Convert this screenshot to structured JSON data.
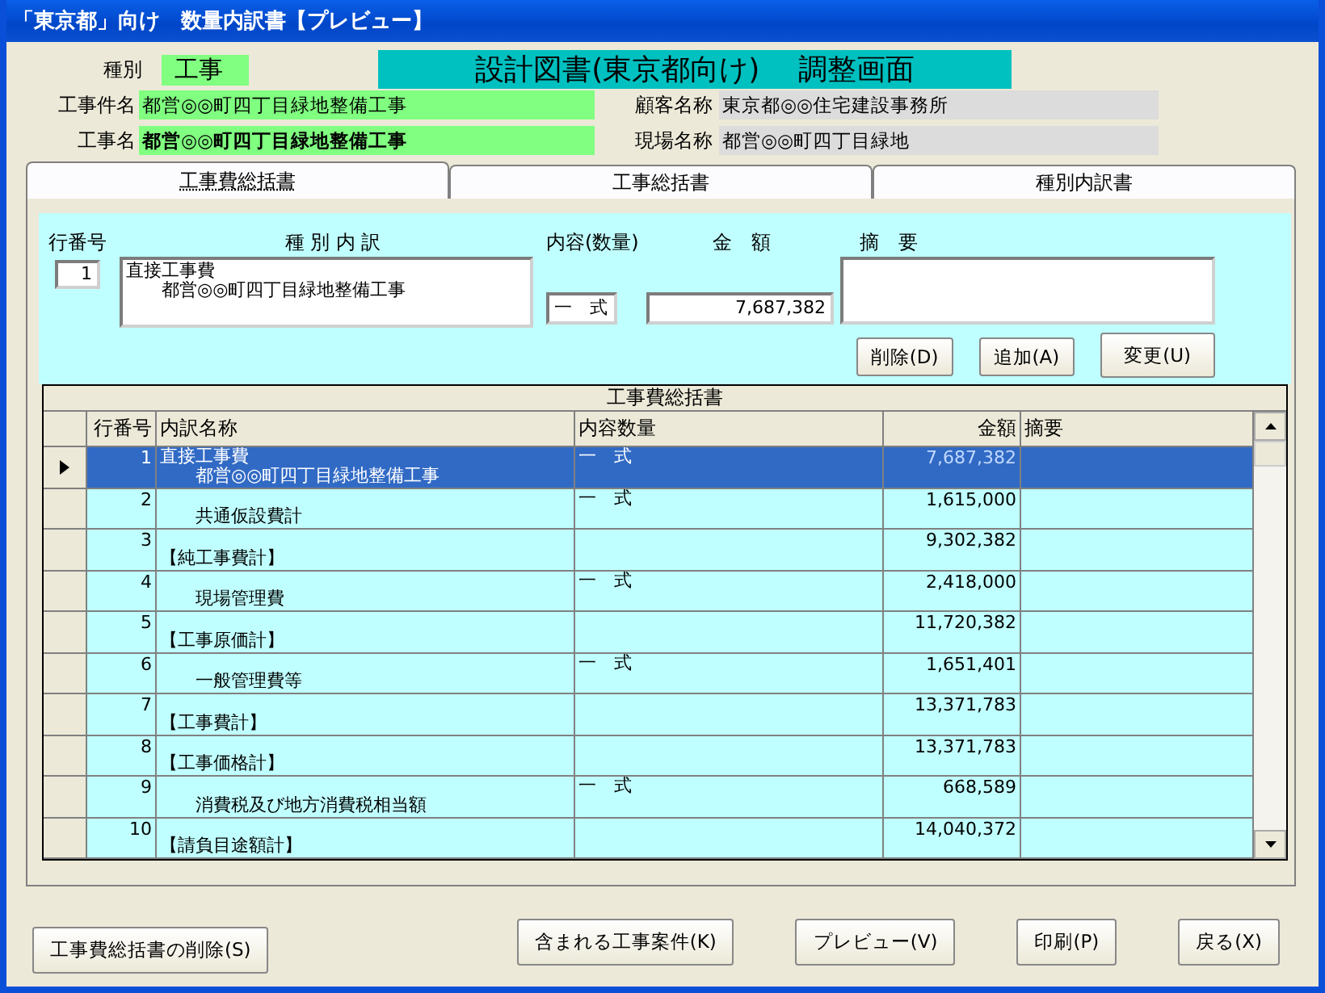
{
  "window": {
    "title": "「東京都」向け　数量内訳書【プレビュー】"
  },
  "header": {
    "type_label": "種別",
    "type_value": "工事",
    "banner": "設計図書(東京都向け)　 調整画面",
    "fields": [
      {
        "label": "工事件名",
        "value": "都営◎◎町四丁目緑地整備工事",
        "kind": "green"
      },
      {
        "label": "顧客名称",
        "value": "東京都◎◎住宅建設事務所",
        "kind": "grey"
      },
      {
        "label": "工事名",
        "value": "都営◎◎町四丁目緑地整備工事",
        "kind": "greenbold"
      },
      {
        "label": "現場名称",
        "value": "都営◎◎町四丁目緑地",
        "kind": "grey"
      }
    ]
  },
  "tabs": [
    {
      "label": "工事費総括書",
      "selected": true
    },
    {
      "label": "工事総括書",
      "selected": false
    },
    {
      "label": "種別内訳書",
      "selected": false
    }
  ],
  "detail": {
    "row_no_label": "行番号",
    "row_no": "1",
    "breakdown_label": "種 別 内 訳",
    "breakdown_lines": [
      "直接工事費",
      "　　都営◎◎町四丁目緑地整備工事"
    ],
    "qty_label": "内容(数量)",
    "qty": "一　式",
    "amount_label": "金　額",
    "amount": "7,687,382",
    "note_label": "摘　要",
    "buttons": [
      "削除(D)",
      "追加(A)",
      "変更(U)"
    ]
  },
  "table": {
    "caption": "工事費総括書",
    "columns": [
      "行番号",
      "内訳名称",
      "内容数量",
      "金額",
      "摘要"
    ],
    "rows": [
      {
        "no": "1",
        "name_top": "直接工事費",
        "name": "　　都営◎◎町四丁目緑地整備工事",
        "qty": "一　式",
        "amount": "7,687,382",
        "selected": true
      },
      {
        "no": "2",
        "name": "　　共通仮設費計",
        "qty": "一　式",
        "amount": "1,615,000",
        "selected": false
      },
      {
        "no": "3",
        "name": "【純工事費計】",
        "amount": "9,302,382",
        "selected": false
      },
      {
        "no": "4",
        "name": "　　現場管理費",
        "qty": "一　式",
        "amount": "2,418,000",
        "selected": false
      },
      {
        "no": "5",
        "name": "【工事原価計】",
        "amount": "11,720,382",
        "selected": false
      },
      {
        "no": "6",
        "name": "　　一般管理費等",
        "qty": "一　式",
        "amount": "1,651,401",
        "selected": false
      },
      {
        "no": "7",
        "name": "【工事費計】",
        "amount": "13,371,783",
        "selected": false
      },
      {
        "no": "8",
        "name": "【工事価格計】",
        "amount": "13,371,783",
        "selected": false
      },
      {
        "no": "9",
        "name": "　　消費税及び地方消費税相当額",
        "qty": "一　式",
        "amount": "668,589",
        "selected": false
      },
      {
        "no": "10",
        "name": "【請負目途額計】",
        "amount": "14,040,372",
        "selected": false
      }
    ]
  },
  "footer_buttons": [
    {
      "label": "工事費総括書の削除(S)",
      "kind": "left"
    },
    {
      "label": "含まれる工事案件(K)",
      "kind": "right"
    },
    {
      "label": "プレビュー(V)",
      "kind": "right"
    },
    {
      "label": "印刷(P)",
      "kind": "right"
    },
    {
      "label": "戻る(X)",
      "kind": "right"
    }
  ]
}
